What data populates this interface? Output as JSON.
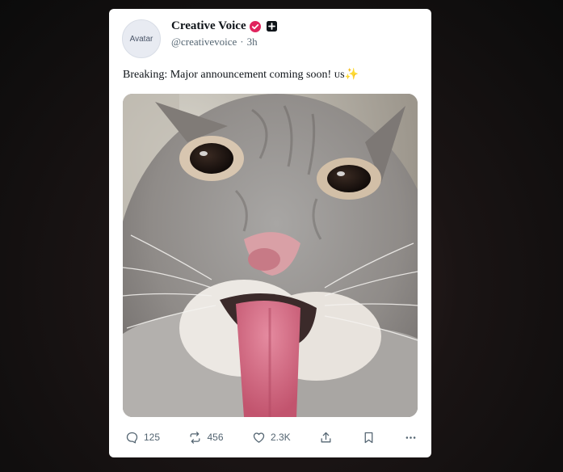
{
  "post": {
    "avatar_text": "Avatar",
    "display_name": "Creative Voice",
    "handle": "@creativevoice",
    "separator": "·",
    "time": "3h",
    "text": "Breaking: Major announcement coming soon! ᴜs✨",
    "verified_color": "#e0245e",
    "media_alt": "Close-up photo of a grey tabby cat sticking out its tongue"
  },
  "actions": {
    "reply_count": "125",
    "repost_count": "456",
    "like_count": "2.3K"
  },
  "icons": {
    "reply": "reply-icon",
    "repost": "repost-icon",
    "like": "heart-icon",
    "share": "share-icon",
    "bookmark": "bookmark-icon",
    "more": "more-icon"
  }
}
